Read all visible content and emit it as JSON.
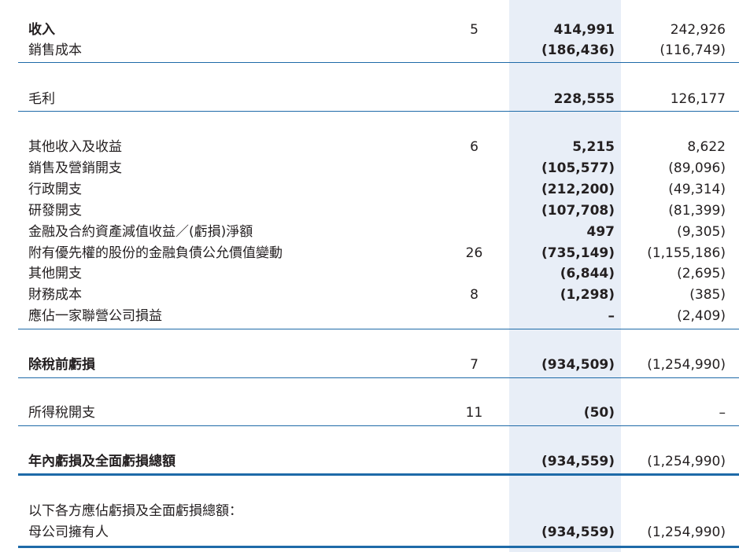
{
  "rows": [
    {
      "label": "收入",
      "note": "5",
      "current": "414,991",
      "prior": "242,926",
      "bold": true
    },
    {
      "label": "銷售成本",
      "note": "",
      "current": "(186,436)",
      "prior": "(116,749)",
      "bold": false
    },
    {
      "label": "毛利",
      "note": "",
      "current": "228,555",
      "prior": "126,177",
      "bold": false
    },
    {
      "label": "其他收入及收益",
      "note": "6",
      "current": "5,215",
      "prior": "8,622",
      "bold": false
    },
    {
      "label": "銷售及營銷開支",
      "note": "",
      "current": "(105,577)",
      "prior": "(89,096)",
      "bold": false
    },
    {
      "label": "行政開支",
      "note": "",
      "current": "(212,200)",
      "prior": "(49,314)",
      "bold": false
    },
    {
      "label": "研發開支",
      "note": "",
      "current": "(107,708)",
      "prior": "(81,399)",
      "bold": false
    },
    {
      "label": "金融及合約資產減值收益／(虧損)淨額",
      "note": "",
      "current": "497",
      "prior": "(9,305)",
      "bold": false
    },
    {
      "label": "附有優先權的股份的金融負債公允價值變動",
      "note": "26",
      "current": "(735,149)",
      "prior": "(1,155,186)",
      "bold": false
    },
    {
      "label": "其他開支",
      "note": "",
      "current": "(6,844)",
      "prior": "(2,695)",
      "bold": false
    },
    {
      "label": "財務成本",
      "note": "8",
      "current": "(1,298)",
      "prior": "(385)",
      "bold": false
    },
    {
      "label": "應佔一家聯營公司損益",
      "note": "",
      "current": "–",
      "prior": "(2,409)",
      "bold": false
    },
    {
      "label": "除稅前虧損",
      "note": "7",
      "current": "(934,509)",
      "prior": "(1,254,990)",
      "bold": true
    },
    {
      "label": "所得稅開支",
      "note": "11",
      "current": "(50)",
      "prior": "–",
      "bold": false
    },
    {
      "label": "年內虧損及全面虧損總額",
      "note": "",
      "current": "(934,559)",
      "prior": "(1,254,990)",
      "bold": true
    },
    {
      "label": "以下各方應佔虧損及全面虧損總額：",
      "note": "",
      "current": "",
      "prior": "",
      "bold": false
    },
    {
      "label": "母公司擁有人",
      "note": "",
      "current": "(934,559)",
      "prior": "(1,254,990)",
      "bold": false
    }
  ],
  "colors": {
    "accent": "#1e6aa8",
    "column_shade": "#e8eef7",
    "text": "#231f20"
  }
}
